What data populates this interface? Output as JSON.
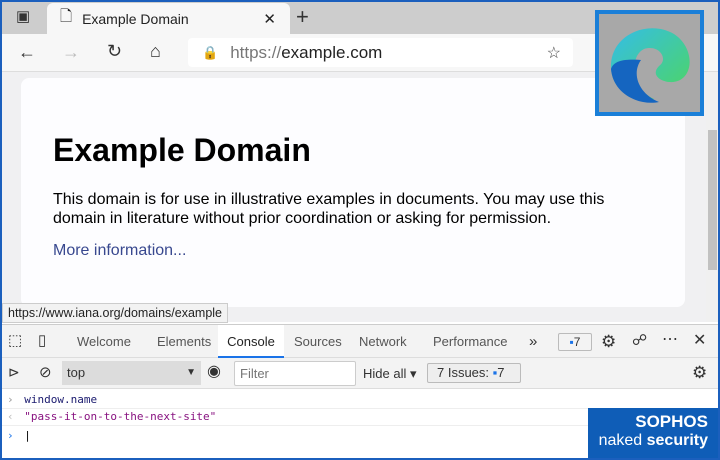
{
  "browser": {
    "tab_title": "Example Domain",
    "url_scheme": "https://",
    "url_host": "example.com",
    "status_url": "https://www.iana.org/domains/example"
  },
  "page": {
    "heading": "Example Domain",
    "paragraph": "This domain is for use in illustrative examples in documents. You may use this domain in literature without prior coordination or asking for permission.",
    "link": "More information..."
  },
  "devtools": {
    "tabs": [
      "Welcome",
      "Elements",
      "Console",
      "Sources",
      "Network",
      "Performance"
    ],
    "active_tab": "Console",
    "more": "»",
    "issues_badge": "7",
    "context": "top",
    "filter_placeholder": "Filter",
    "levels": "Hide all ▾",
    "issues_label": "7 Issues:",
    "issues_count": "7"
  },
  "console": {
    "input": "window.name",
    "output": "\"pass-it-on-to-the-next-site\""
  },
  "watermark": {
    "brand": "SOPHOS",
    "sub1": "naked",
    "sub2": "security"
  },
  "colors": {
    "accent": "#1a73e8",
    "link": "#38488f",
    "string": "#881280"
  }
}
